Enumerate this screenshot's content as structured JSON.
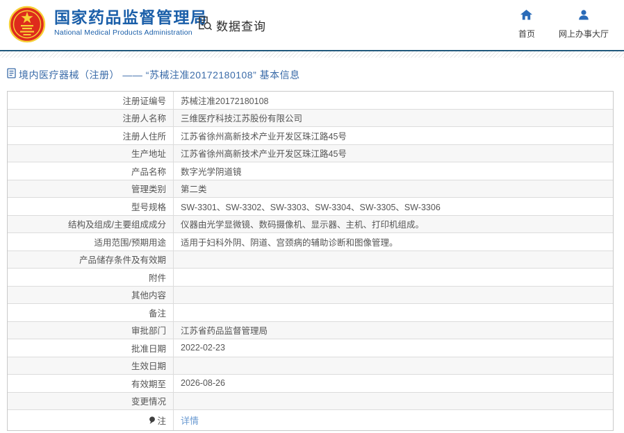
{
  "header": {
    "org_name_cn": "国家药品监督管理局",
    "org_name_en": "National Medical Products Administration",
    "section_title": "数据查询",
    "nav": [
      {
        "label": "首页",
        "icon": "home-icon"
      },
      {
        "label": "网上办事大厅",
        "icon": "user-icon"
      }
    ]
  },
  "breadcrumb": {
    "text": "境内医疗器械（注册） —— “苏械注准20172180108” 基本信息"
  },
  "table": {
    "rows": [
      {
        "label": "注册证编号",
        "value": "苏械注准20172180108"
      },
      {
        "label": "注册人名称",
        "value": "三维医疗科技江苏股份有限公司"
      },
      {
        "label": "注册人住所",
        "value": "江苏省徐州高新技术产业开发区珠江路45号"
      },
      {
        "label": "生产地址",
        "value": "江苏省徐州高新技术产业开发区珠江路45号"
      },
      {
        "label": "产品名称",
        "value": "数字光学阴道镜"
      },
      {
        "label": "管理类别",
        "value": "第二类"
      },
      {
        "label": "型号规格",
        "value": "SW-3301、SW-3302、SW-3303、SW-3304、SW-3305、SW-3306"
      },
      {
        "label": "结构及组成/主要组成成分",
        "value": "仪器由光学显微镜、数码摄像机、显示器、主机、打印机组成。"
      },
      {
        "label": "适用范围/预期用途",
        "value": "适用于妇科外阴、阴道、宫颈病的辅助诊断和图像管理。"
      },
      {
        "label": "产品储存条件及有效期",
        "value": ""
      },
      {
        "label": "附件",
        "value": ""
      },
      {
        "label": "其他内容",
        "value": ""
      },
      {
        "label": "备注",
        "value": ""
      },
      {
        "label": "审批部门",
        "value": "江苏省药品监督管理局"
      },
      {
        "label": "批准日期",
        "value": "2022-02-23"
      },
      {
        "label": "生效日期",
        "value": ""
      },
      {
        "label": "有效期至",
        "value": "2026-08-26"
      },
      {
        "label": "变更情况",
        "value": ""
      },
      {
        "label": "注",
        "value": "详情",
        "is_link": true,
        "label_icon": "pin-icon"
      }
    ]
  },
  "icons": {
    "logo": "national-emblem-icon",
    "data_query": "document-search-icon",
    "breadcrumb": "document-icon",
    "note_row": "pin-icon"
  },
  "colors": {
    "brand_blue": "#1b5fa9",
    "nav_icon_blue": "#2a6bb8",
    "divider_blue": "#20587c",
    "breadcrumb_blue": "#3a6ba8",
    "link_blue": "#6b9bd2",
    "emblem_red": "#de2b1c",
    "emblem_gold": "#f7d036",
    "row_alt_bg": "#f7f7f7",
    "border_gray": "#c9c9c9"
  }
}
